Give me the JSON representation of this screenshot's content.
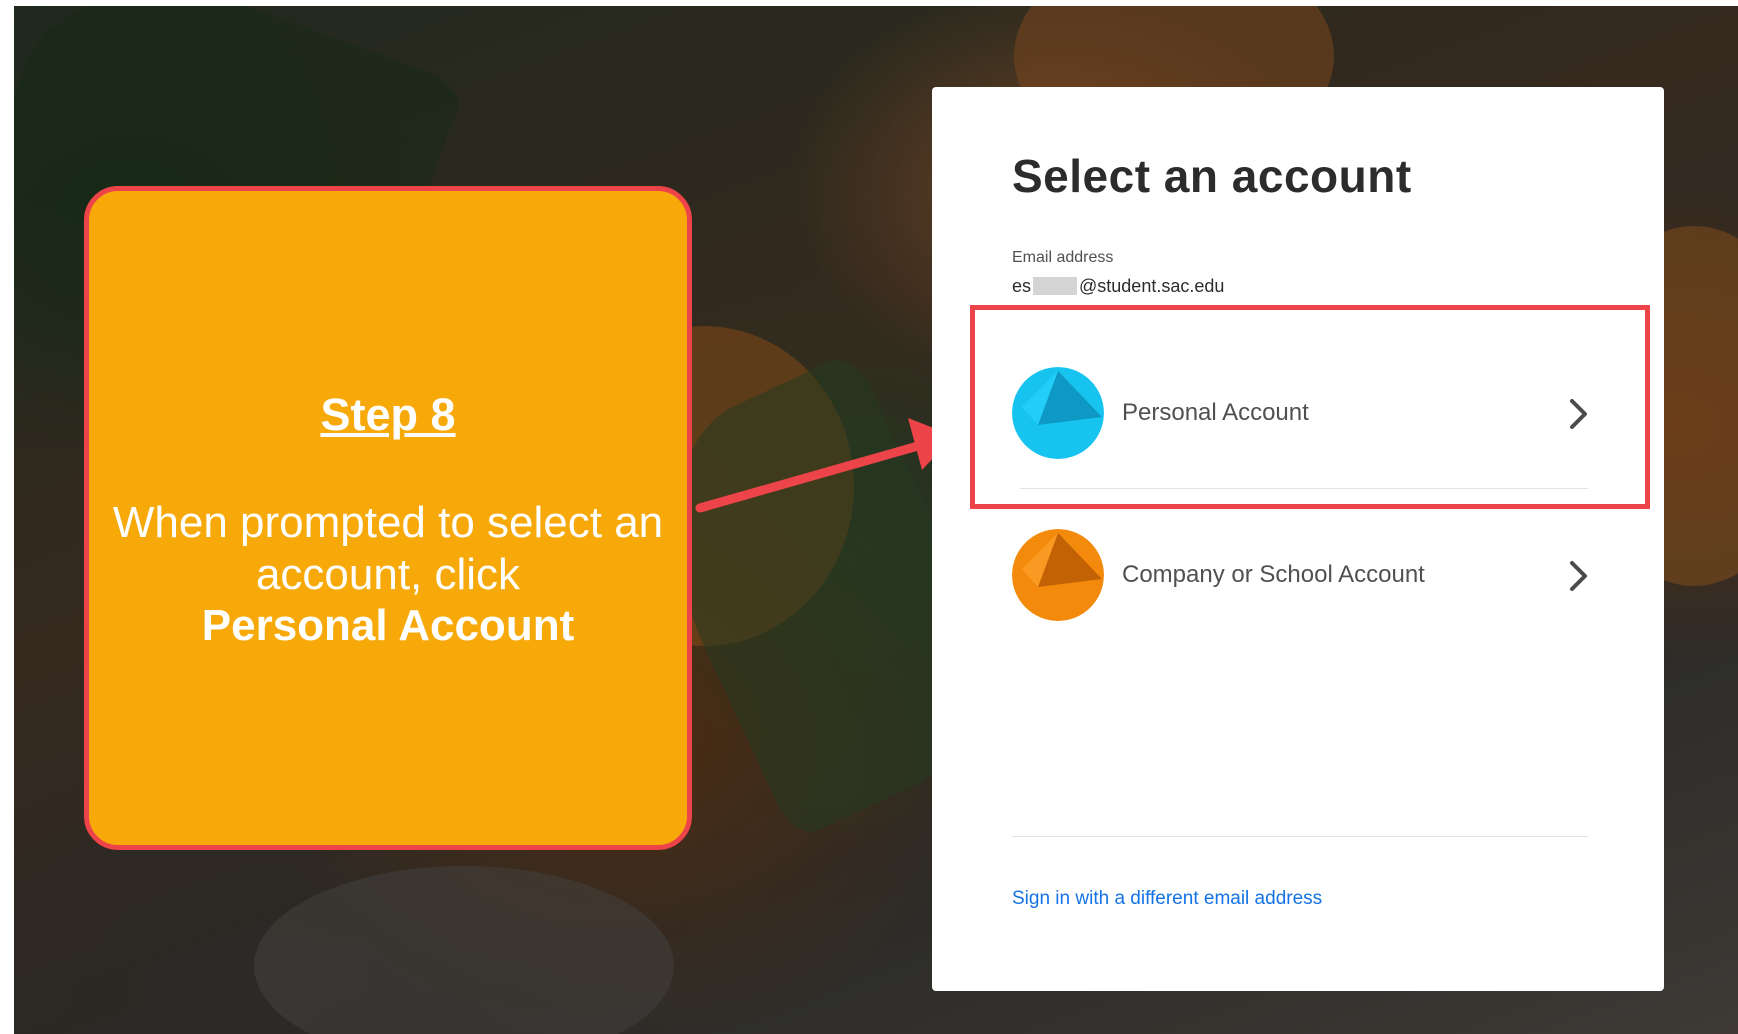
{
  "callout": {
    "step": "Step 8",
    "instruction": "When prompted to select an account, click",
    "target": "Personal Account"
  },
  "card": {
    "title": "Select an account",
    "email_label": "Email address",
    "email_prefix": "es",
    "email_suffix": "@student.sac.edu",
    "accounts": [
      {
        "label": "Personal Account",
        "icon": "personal-account-avatar",
        "color": "#17c4f0"
      },
      {
        "label": "Company or School Account",
        "icon": "school-account-avatar",
        "color": "#f48a0c"
      }
    ],
    "alt_link": "Sign in with a different email address"
  },
  "colors": {
    "callout_bg": "#f7a90a",
    "highlight": "#ec4449",
    "link": "#1473e6"
  }
}
